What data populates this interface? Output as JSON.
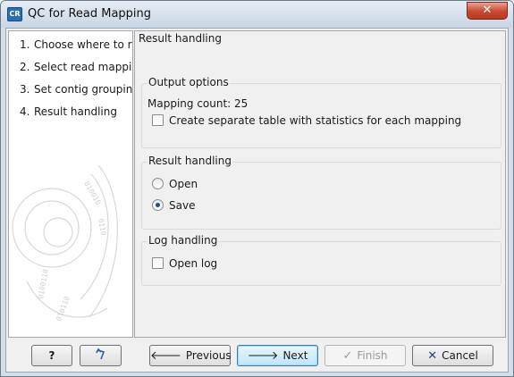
{
  "window": {
    "title": "QC for Read Mapping",
    "app_icon_text": "CR",
    "close_glyph": "✕"
  },
  "steps": [
    {
      "num": "1.",
      "label": "Choose where to run"
    },
    {
      "num": "2.",
      "label": "Select read mappings"
    },
    {
      "num": "3.",
      "label": "Set contig grouping"
    },
    {
      "num": "4.",
      "label": "Result handling"
    }
  ],
  "panel": {
    "title": "Result handling",
    "output_options": {
      "title": "Output options",
      "mapping_count": "Mapping count: 25",
      "separate_table_label": "Create separate table with statistics for each mapping",
      "separate_table_checked": false
    },
    "result_handling": {
      "title": "Result handling",
      "options": [
        {
          "label": "Open",
          "checked": false
        },
        {
          "label": "Save",
          "checked": true
        }
      ]
    },
    "log_handling": {
      "title": "Log handling",
      "open_log_label": "Open log",
      "open_log_checked": false
    }
  },
  "buttons": {
    "help": "?",
    "reset_icon": "reset-icon",
    "previous": "Previous",
    "next": "Next",
    "finish": "Finish",
    "cancel": "Cancel"
  },
  "colors": {
    "accent": "#3c7fb1",
    "close": "#c9482f",
    "cancel_x": "#1f3f8c"
  }
}
